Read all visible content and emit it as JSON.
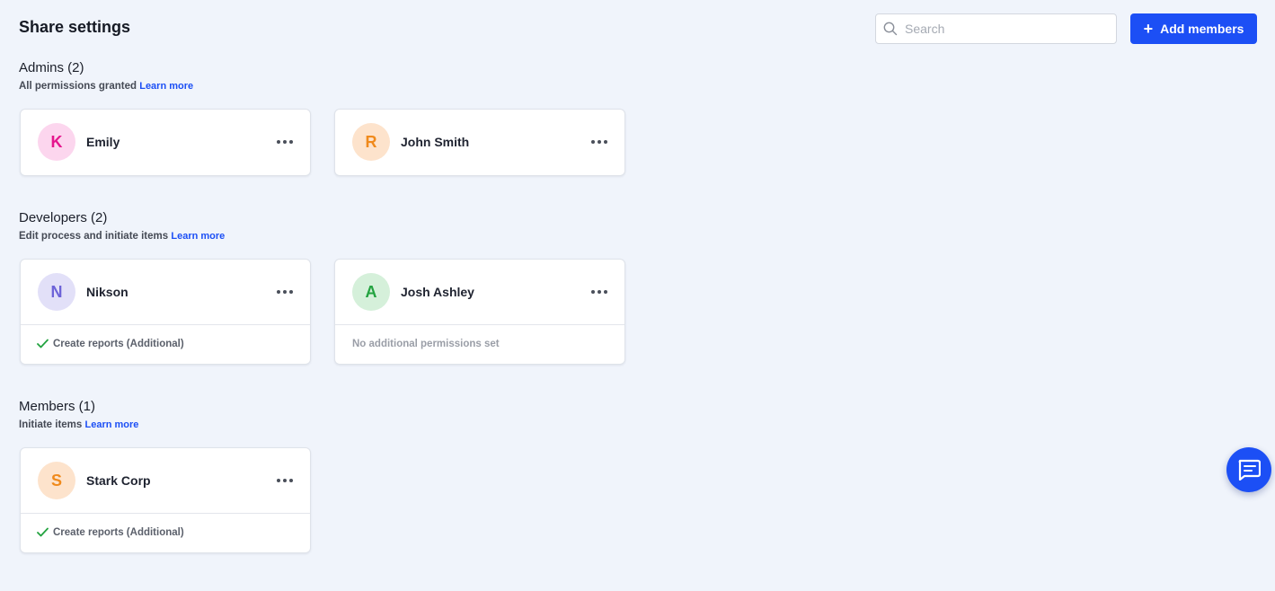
{
  "header": {
    "title": "Share settings",
    "search_placeholder": "Search",
    "add_button_label": "Add members"
  },
  "sections": [
    {
      "title": "Admins (2)",
      "description": "All permissions granted",
      "learn_more": "Learn more",
      "members": [
        {
          "initial": "K",
          "name": "Emily",
          "avatar_bg": "#fcd6ee",
          "avatar_fg": "#e5168e"
        },
        {
          "initial": "R",
          "name": "John Smith",
          "avatar_bg": "#fde3cc",
          "avatar_fg": "#f08a1c"
        }
      ]
    },
    {
      "title": "Developers (2)",
      "description": "Edit process and initiate items",
      "learn_more": "Learn more",
      "members": [
        {
          "initial": "N",
          "name": "Nikson",
          "avatar_bg": "#e2e0f8",
          "avatar_fg": "#6d63d8",
          "permission": "Create reports (Additional)"
        },
        {
          "initial": "A",
          "name": "Josh Ashley",
          "avatar_bg": "#d5f0da",
          "avatar_fg": "#23a340",
          "permission": "No additional permissions set"
        }
      ]
    },
    {
      "title": "Members (1)",
      "description": "Initiate items",
      "learn_more": "Learn more",
      "members": [
        {
          "initial": "S",
          "name": "Stark Corp",
          "avatar_bg": "#fde3cc",
          "avatar_fg": "#f08a1c",
          "permission": "Create reports (Additional)"
        }
      ]
    }
  ],
  "colors": {
    "accent": "#1c4ff5",
    "background": "#f0f4fb",
    "check": "#23a340"
  },
  "icons": {
    "search": "search-icon",
    "add": "plus-icon",
    "more": "more-horizontal-icon",
    "check": "check-icon",
    "chat": "chat-icon"
  }
}
